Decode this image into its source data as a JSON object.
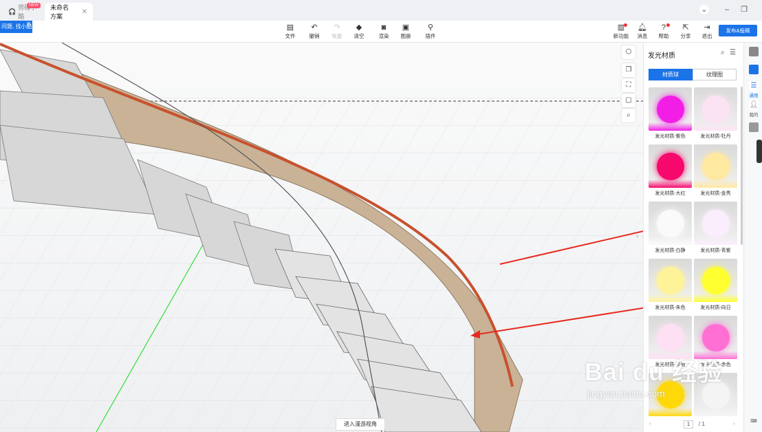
{
  "tabs": [
    {
      "label": "劳碌小酷",
      "badge": "NEW"
    },
    {
      "label": "未命名方案"
    }
  ],
  "help_popup": {
    "label": "问题, 找小酷"
  },
  "toolbar": {
    "items": [
      {
        "label": "文件",
        "icon": "file-icon",
        "disabled": false
      },
      {
        "label": "撤销",
        "icon": "undo-icon",
        "disabled": false
      },
      {
        "label": "恢复",
        "icon": "redo-icon",
        "disabled": true
      },
      {
        "label": "清空",
        "icon": "eraser-icon",
        "disabled": false
      },
      {
        "label": "渲染",
        "icon": "render-icon",
        "disabled": false
      },
      {
        "label": "图册",
        "icon": "album-icon",
        "disabled": false
      },
      {
        "label": "插件",
        "icon": "plugin-icon",
        "disabled": false
      }
    ],
    "right_items": [
      {
        "label": "新功能",
        "icon": "new-feature-icon",
        "dot": true
      },
      {
        "label": "消息",
        "icon": "bell-icon",
        "dot": false
      },
      {
        "label": "帮助",
        "icon": "help-icon",
        "dot": true
      },
      {
        "label": "分享",
        "icon": "share-icon",
        "dot": false
      },
      {
        "label": "退出",
        "icon": "exit-icon",
        "dot": false
      }
    ],
    "publish_label": "发布&投稿"
  },
  "viewport": {
    "roam_button": "进入漫游视角",
    "colors": {
      "rail": "#c8512e",
      "wall": "#c9b296",
      "step": "#d8d8d8"
    }
  },
  "panel": {
    "title": "发光材质",
    "segments": [
      "材质球",
      "纹理图"
    ],
    "materials": [
      {
        "label": "发光材质-紫色",
        "color": "#f21ee6"
      },
      {
        "label": "发光材质-牡丹",
        "color": "#fbe3f3"
      },
      {
        "label": "发光材质-大红",
        "color": "#f7086d"
      },
      {
        "label": "发光材质-金秀",
        "color": "#ffe8a0"
      },
      {
        "label": "发光材质-白静",
        "color": "#fafafa"
      },
      {
        "label": "发光材质-青紫",
        "color": "#fbeefc"
      },
      {
        "label": "发光材质-朱色",
        "color": "#fff39a"
      },
      {
        "label": "发光材质-向日",
        "color": "#ffff30"
      },
      {
        "label": "发光材质-青丽",
        "color": "#fde0f4"
      },
      {
        "label": "发光材质-赤色",
        "color": "#ff6fd4"
      },
      {
        "label": "",
        "color": "#ffd80a"
      },
      {
        "label": "",
        "color": "#f4f4f4"
      }
    ],
    "pager": {
      "current": "1",
      "total": "/ 1"
    }
  },
  "rail": {
    "items": [
      {
        "label": "",
        "icon": "model-icon"
      },
      {
        "label": "",
        "icon": "material-icon"
      },
      {
        "label": "通用",
        "icon": "list-icon"
      },
      {
        "label": "我的",
        "icon": "user-icon"
      },
      {
        "label": "",
        "icon": "cube-icon"
      }
    ]
  },
  "watermark": {
    "logo": "Bai du 经验",
    "sub": "jingyan.baidu.com"
  }
}
